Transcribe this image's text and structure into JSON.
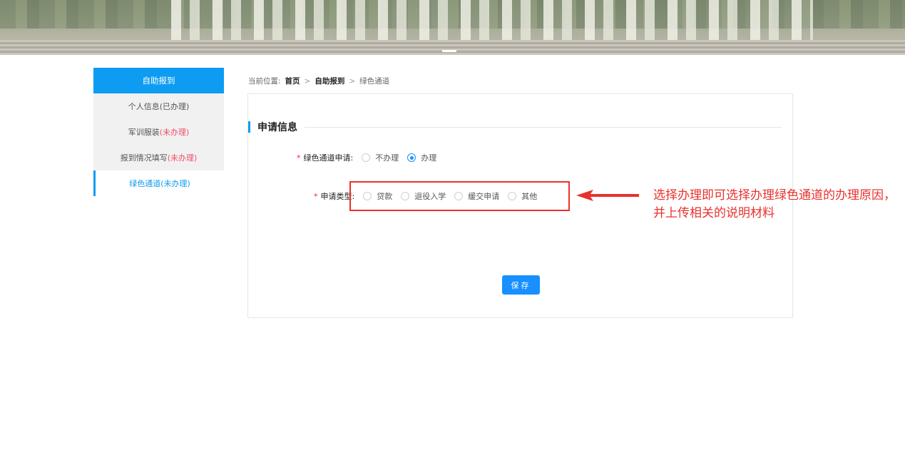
{
  "sidebar": {
    "header": "自助报到",
    "items": [
      {
        "label": "个人信息(已办理)",
        "status": ""
      },
      {
        "label": "军训服装",
        "status": "(未办理)"
      },
      {
        "label": "报到情况填写",
        "status": "(未办理)"
      },
      {
        "label": "绿色通道(未办理)",
        "status": ""
      }
    ]
  },
  "breadcrumb": {
    "prefix": "当前位置:",
    "home": "首页",
    "sep1": ">",
    "parent": "自助报到",
    "sep2": ">",
    "current": "绿色通道"
  },
  "form": {
    "section_title": "申请信息",
    "apply": {
      "star": "*",
      "label": "绿色通道申请:",
      "options": [
        "不办理",
        "办理"
      ],
      "selected": "办理"
    },
    "type": {
      "star": "*",
      "label": "申请类型:",
      "options": [
        "贷款",
        "退役入学",
        "缓交申请",
        "其他"
      ],
      "selected": ""
    },
    "save_label": "保存"
  },
  "annotation": {
    "text": "选择办理即可选择办理绿色通道的办理原因，并上传相关的说明材料",
    "color": "#e8312d"
  },
  "colors": {
    "accent": "#0e9cf2",
    "button": "#1890ff",
    "pending": "#f0506a"
  }
}
